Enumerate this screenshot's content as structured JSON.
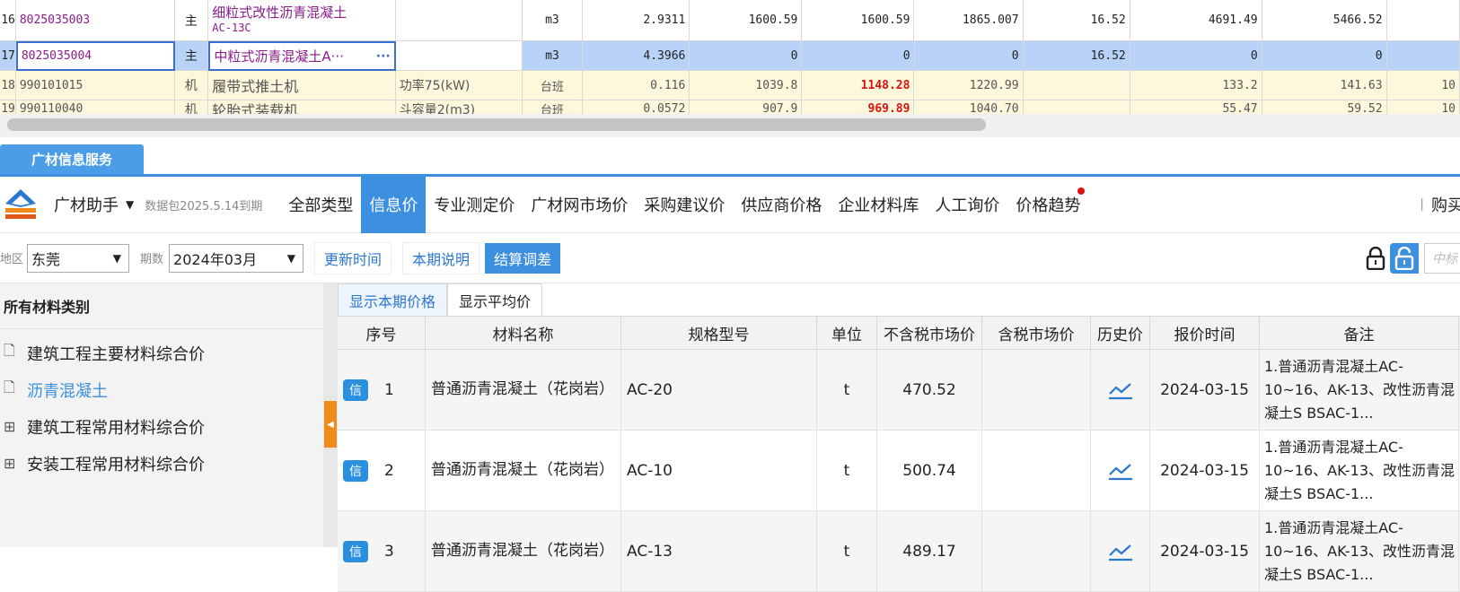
{
  "top_grid": {
    "rows": [
      {
        "rownum": "16",
        "code": "8025035003",
        "type": "主",
        "name": "细粒式改性沥青混凝土",
        "name_sub": "AC-13C",
        "spec": "",
        "unit": "m3",
        "v1": "2.9311",
        "v2": "1600.59",
        "v3": "1600.59",
        "v4": "1865.007",
        "v5": "16.52",
        "v6": "4691.49",
        "v7": "5466.52",
        "v8": ""
      },
      {
        "rownum": "17",
        "code": "8025035004",
        "type": "主",
        "name": "中粒式沥青混凝土A···",
        "name_more": "···",
        "spec": "",
        "unit": "m3",
        "v1": "4.3966",
        "v2": "0",
        "v3": "0",
        "v4": "0",
        "v5": "16.52",
        "v6": "0",
        "v7": "0",
        "v8": ""
      },
      {
        "rownum": "18",
        "code": "990101015",
        "type": "机",
        "name": "履带式推土机",
        "spec": "功率75(kW)",
        "unit": "台班",
        "v1": "0.116",
        "v2": "1039.8",
        "v3": "1148.28",
        "v4": "1220.99",
        "v5": "",
        "v6": "133.2",
        "v7": "141.63",
        "v8": "10"
      },
      {
        "rownum": "19",
        "code": "990110040",
        "type": "机",
        "name": "轮胎式装载机",
        "spec": "斗容量2(m3)",
        "unit": "台班",
        "v1": "0.0572",
        "v2": "907.9",
        "v3": "969.89",
        "v4": "1040.70",
        "v5": "",
        "v6": "55.47",
        "v7": "59.52",
        "v8": "10"
      }
    ]
  },
  "service_tab": "广材信息服务",
  "nav": {
    "brand": "广材助手",
    "package_info": "数据包2025.5.14到期",
    "items": [
      "全部类型",
      "信息价",
      "专业测定价",
      "广材网市场价",
      "采购建议价",
      "供应商价格",
      "企业材料库",
      "人工询价",
      "价格趋势"
    ],
    "active": "信息价",
    "right_sep": "|",
    "right_item": "购买"
  },
  "filter": {
    "region_label": "地区",
    "region_value": "东莞",
    "period_label": "期数",
    "period_value": "2024年03月",
    "btn_update": "更新时间",
    "btn_notes": "本期说明",
    "btn_settle": "结算调差",
    "search_placeholder": "中标"
  },
  "tree": {
    "header": "所有材料类别",
    "items": [
      {
        "icon": "doc",
        "label": "建筑工程主要材料综合价"
      },
      {
        "icon": "doc",
        "label": "沥青混凝土"
      },
      {
        "icon": "plus",
        "label": "建筑工程常用材料综合价"
      },
      {
        "icon": "plus",
        "label": "安装工程常用材料综合价"
      }
    ],
    "selected_index": 1
  },
  "table": {
    "subtabs": [
      "显示本期价格",
      "显示平均价"
    ],
    "headers": [
      "序号",
      "材料名称",
      "规格型号",
      "单位",
      "不含税市场价",
      "含税市场价",
      "历史价",
      "报价时间",
      "备注"
    ],
    "badge": "信",
    "rows": [
      {
        "seq": "1",
        "name": "普通沥青混凝土（花岗岩）",
        "spec": "AC-20",
        "unit": "t",
        "price": "470.52",
        "tax_price": "",
        "date": "2024-03-15",
        "remark": "1.普通沥青混凝土AC-10~16、AK-13、改性沥青混凝土S BSAC-1..."
      },
      {
        "seq": "2",
        "name": "普通沥青混凝土（花岗岩）",
        "spec": "AC-10",
        "unit": "t",
        "price": "500.74",
        "tax_price": "",
        "date": "2024-03-15",
        "remark": "1.普通沥青混凝土AC-10~16、AK-13、改性沥青混凝土S BSAC-1..."
      },
      {
        "seq": "3",
        "name": "普通沥青混凝土（花岗岩）",
        "spec": "AC-13",
        "unit": "t",
        "price": "489.17",
        "tax_price": "",
        "date": "2024-03-15",
        "remark": "1.普通沥青混凝土AC-10~16、AK-13、改性沥青混凝土S BSAC-1..."
      }
    ]
  },
  "colors": {
    "accent": "#3d8fe0",
    "red": "#e01010",
    "purple": "#8a1b8a",
    "selected_row": "#b8d3f7",
    "machine_row": "#fdf7dc",
    "handle": "#f08a1c"
  }
}
